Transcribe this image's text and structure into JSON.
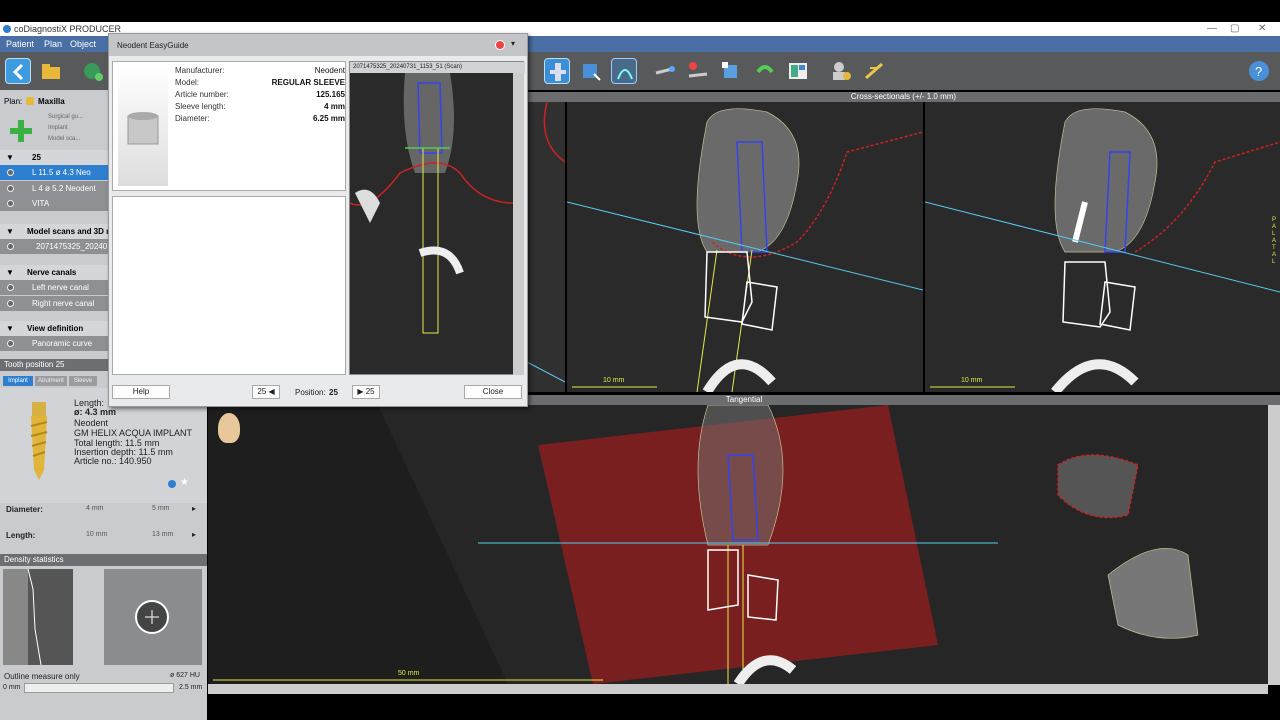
{
  "window": {
    "title": "coDiagnostiX PRODUCER"
  },
  "menu": {
    "items": [
      "Patient",
      "Plan",
      "Object"
    ]
  },
  "plan": {
    "label": "Plan:",
    "name": "Maxilla",
    "tool_labels": [
      "Surgical gu...",
      "Implant",
      "Model sca..."
    ]
  },
  "tree": {
    "group": "25",
    "implants": [
      {
        "text": "L 11.5 ø 4.3 Neo"
      },
      {
        "text": "L 4 ø 5.2 Neodent"
      },
      {
        "text": "VITA"
      }
    ],
    "model_scans_header": "Model scans and 3D m",
    "scan_item": "2071475325_2024073",
    "nerve_header": "Nerve canals",
    "nerves": [
      "Left nerve canal",
      "Right nerve canal"
    ],
    "view_header": "View definition",
    "view_item": "Panoramic curve"
  },
  "tooth": {
    "header": "Tooth position 25",
    "tabs": [
      "Implant",
      "Abutment",
      "Sleeve"
    ],
    "length_label": "Length:",
    "diameter": "ø: 4.3 mm",
    "manufacturer": "Neodent",
    "model": "GM HELIX ACQUA IMPLANT",
    "total_length": "Total length: 11.5 mm",
    "insertion_depth": "Insertion depth: 11.5 mm",
    "article": "Article no.: 140.950",
    "diameter_row": {
      "label": "Diameter:",
      "values": [
        "4 mm",
        "5 mm"
      ]
    },
    "length_row": {
      "label": "Length:",
      "values": [
        "10 mm",
        "13 mm"
      ]
    }
  },
  "density": {
    "header": "Density statistics",
    "outline": "Outline measure only",
    "hu": "ø 627 HU",
    "slider_min": "0 mm",
    "slider_max": "2.5 mm"
  },
  "views": {
    "cross_title": "Cross-sectionals (+/- 1.0 mm)",
    "tangential_title": "Tangential",
    "scale_10": "10 mm",
    "scale_50": "50 mm",
    "palatal": "P A L A T A L"
  },
  "dialog": {
    "title": "Neodent EasyGuide",
    "fields": [
      {
        "k": "Manufacturer:",
        "v": "Neodent"
      },
      {
        "k": "Model:",
        "v": "REGULAR SLEEVE"
      },
      {
        "k": "Article number:",
        "v": "125.165"
      },
      {
        "k": "Sleeve length:",
        "v": "4 mm"
      },
      {
        "k": "Diameter:",
        "v": "6.25 mm"
      }
    ],
    "scan_label": "2071475325_20240731_1153_51 (Scan)",
    "help": "Help",
    "prev": "25 ◀",
    "position_label": "Position:",
    "position_value": "25",
    "next": "▶ 25",
    "close": "Close"
  },
  "colors": {
    "accent": "#2f7fd0",
    "menubar": "#4a6fa5",
    "nerve": "#cc2222",
    "sleeve": "#e8e84a",
    "axis": "#58c8f0"
  }
}
